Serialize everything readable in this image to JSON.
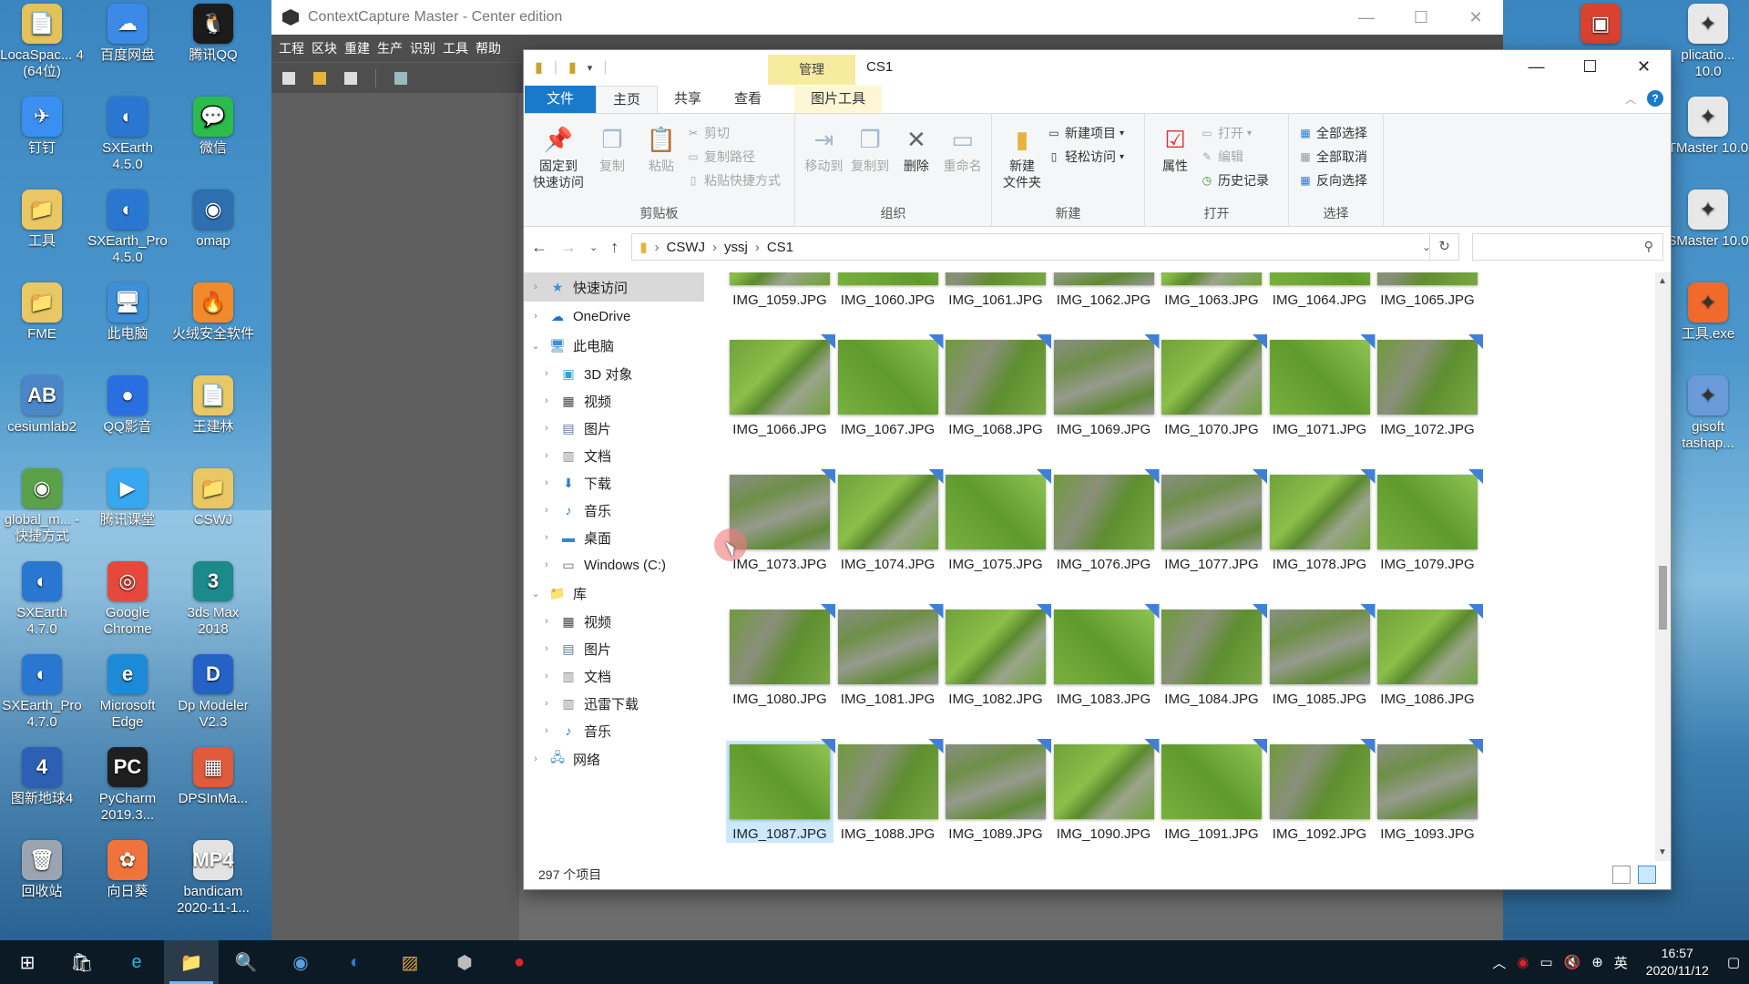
{
  "desktop": {
    "icons": [
      {
        "label": "LocaSpac... 4 (64位)",
        "color": "#e3c15b",
        "glyph": "📄",
        "col": 0,
        "row": 0
      },
      {
        "label": "钉钉",
        "color": "#3b8ff0",
        "glyph": "✈",
        "col": 0,
        "row": 1
      },
      {
        "label": "工具",
        "color": "#e9c764",
        "glyph": "📁",
        "col": 0,
        "row": 2
      },
      {
        "label": "FME",
        "color": "#e9c764",
        "glyph": "📁",
        "col": 0,
        "row": 3
      },
      {
        "label": "cesiumlab2",
        "color": "#4a86c8",
        "glyph": "AB",
        "col": 0,
        "row": 4
      },
      {
        "label": "global_m... - 快捷方式",
        "color": "#5aa14a",
        "glyph": "◉",
        "col": 0,
        "row": 5
      },
      {
        "label": "SXEarth 4.7.0",
        "color": "#2a77d1",
        "glyph": "◐",
        "col": 0,
        "row": 6
      },
      {
        "label": "SXEarth_Pro 4.7.0",
        "color": "#2a77d1",
        "glyph": "◐",
        "col": 0,
        "row": 7
      },
      {
        "label": "图新地球4",
        "color": "#2c60b5",
        "glyph": "4",
        "col": 0,
        "row": 8
      },
      {
        "label": "回收站",
        "color": "#9aa5b1",
        "glyph": "🗑",
        "col": 0,
        "row": 9
      },
      {
        "label": "百度网盘",
        "color": "#3d8ae6",
        "glyph": "☁",
        "col": 1,
        "row": 0
      },
      {
        "label": "SXEarth 4.5.0",
        "color": "#2a77d1",
        "glyph": "◐",
        "col": 1,
        "row": 1
      },
      {
        "label": "SXEarth_Pro 4.5.0",
        "color": "#2a77d1",
        "glyph": "◐",
        "col": 1,
        "row": 2
      },
      {
        "label": "此电脑",
        "color": "#3f8fd6",
        "glyph": "🖥",
        "col": 1,
        "row": 3
      },
      {
        "label": "QQ影音",
        "color": "#2a6fe0",
        "glyph": "●",
        "col": 1,
        "row": 4
      },
      {
        "label": "腾讯课堂",
        "color": "#37a7f0",
        "glyph": "▶",
        "col": 1,
        "row": 5
      },
      {
        "label": "Google Chrome",
        "color": "#e6493c",
        "glyph": "◎",
        "col": 1,
        "row": 6
      },
      {
        "label": "Microsoft Edge",
        "color": "#1d8ad7",
        "glyph": "e",
        "col": 1,
        "row": 7
      },
      {
        "label": "PyCharm 2019.3...",
        "color": "#1f1f1f",
        "glyph": "PC",
        "col": 1,
        "row": 8
      },
      {
        "label": "向日葵",
        "color": "#f0733b",
        "glyph": "✿",
        "col": 1,
        "row": 9
      },
      {
        "label": "腾讯QQ",
        "color": "#1b1b1b",
        "glyph": "🐧",
        "col": 2,
        "row": 0
      },
      {
        "label": "微信",
        "color": "#2cbc4b",
        "glyph": "💬",
        "col": 2,
        "row": 1
      },
      {
        "label": "omap",
        "color": "#2e6fb0",
        "glyph": "◉",
        "col": 2,
        "row": 2
      },
      {
        "label": "火绒安全软件",
        "color": "#f28a2b",
        "glyph": "🔥",
        "col": 2,
        "row": 3
      },
      {
        "label": "王建林",
        "color": "#e9c764",
        "glyph": "📄",
        "col": 2,
        "row": 4
      },
      {
        "label": "CSWJ",
        "color": "#e9c764",
        "glyph": "📁",
        "col": 2,
        "row": 5
      },
      {
        "label": "3ds Max 2018",
        "color": "#1a8a8a",
        "glyph": "3",
        "col": 2,
        "row": 6
      },
      {
        "label": "Dp Modeler V2.3",
        "color": "#2462c5",
        "glyph": "D",
        "col": 2,
        "row": 7
      },
      {
        "label": "DPSInMa...",
        "color": "#e05a3b",
        "glyph": "▦",
        "col": 2,
        "row": 8
      },
      {
        "label": "bandicam 2020-11-1...",
        "color": "#e3e3e3",
        "glyph": "MP4",
        "col": 2,
        "row": 9
      }
    ],
    "right_icons": [
      {
        "label": "",
        "color": "#d8432f",
        "glyph": "▣",
        "row": 0
      },
      {
        "label": "",
        "color": "#2d6ad0",
        "glyph": "◐",
        "row": 4
      }
    ],
    "right_labels": [
      {
        "label": "plicatio... 10.0",
        "row": 0
      },
      {
        "label": "TMaster 10.0",
        "row": 1
      },
      {
        "label": "SMaster 10.0",
        "row": 2
      },
      {
        "label": "工具.exe",
        "row": 3
      },
      {
        "label": "gisoft tashap...",
        "row": 4
      }
    ]
  },
  "contextcapture": {
    "title": "ContextCapture Master - Center edition",
    "menu": [
      "工程",
      "区块",
      "重建",
      "生产",
      "识别",
      "工具",
      "帮助"
    ]
  },
  "explorer": {
    "title": "CS1",
    "context_tab": "管理",
    "tabs": {
      "file": "文件",
      "home": "主页",
      "share": "共享",
      "view": "查看",
      "picture_tools": "图片工具"
    },
    "ribbon": {
      "clipboard": {
        "group": "剪贴板",
        "pin": "固定到\n快速访问",
        "copy": "复制",
        "paste": "粘贴",
        "cut": "剪切",
        "copy_path": "复制路径",
        "paste_shortcut": "粘贴快捷方式"
      },
      "organize": {
        "group": "组织",
        "move_to": "移动到",
        "copy_to": "复制到",
        "delete": "删除",
        "rename": "重命名"
      },
      "new": {
        "group": "新建",
        "new_folder": "新建\n文件夹",
        "new_item": "新建项目",
        "easy_access": "轻松访问"
      },
      "open": {
        "group": "打开",
        "properties": "属性",
        "open": "打开",
        "edit": "编辑",
        "history": "历史记录"
      },
      "select": {
        "group": "选择",
        "select_all": "全部选择",
        "select_none": "全部取消",
        "invert": "反向选择"
      }
    },
    "address": {
      "crumbs": [
        "CSWJ",
        "yssj",
        "CS1"
      ]
    },
    "search": {
      "placeholder": ""
    },
    "nav": [
      {
        "label": "快速访问",
        "level": 0,
        "chev": "›",
        "icon": "★",
        "color": "#3a8ee6",
        "sel": true
      },
      {
        "label": "OneDrive",
        "level": 0,
        "chev": "›",
        "icon": "☁",
        "color": "#1a74d0",
        "gap": true
      },
      {
        "label": "此电脑",
        "level": 0,
        "chev": "⌄",
        "icon": "🖥",
        "color": "#3f8fd6",
        "gap": true
      },
      {
        "label": "3D 对象",
        "level": 1,
        "chev": "›",
        "icon": "▣",
        "color": "#31a4d6"
      },
      {
        "label": "视频",
        "level": 1,
        "chev": "›",
        "icon": "▦",
        "color": "#444"
      },
      {
        "label": "图片",
        "level": 1,
        "chev": "›",
        "icon": "▤",
        "color": "#5a7aa0"
      },
      {
        "label": "文档",
        "level": 1,
        "chev": "›",
        "icon": "▥",
        "color": "#888"
      },
      {
        "label": "下载",
        "level": 1,
        "chev": "›",
        "icon": "⬇",
        "color": "#2a7fd6"
      },
      {
        "label": "音乐",
        "level": 1,
        "chev": "›",
        "icon": "♪",
        "color": "#2a7fd6"
      },
      {
        "label": "桌面",
        "level": 1,
        "chev": "›",
        "icon": "▬",
        "color": "#2a8ad6"
      },
      {
        "label": "Windows (C:)",
        "level": 1,
        "chev": "›",
        "icon": "▭",
        "color": "#666"
      },
      {
        "label": "库",
        "level": 0,
        "chev": "⌄",
        "icon": "📁",
        "color": "#e2b23c",
        "gap": true
      },
      {
        "label": "视频",
        "level": 1,
        "chev": "›",
        "icon": "▦",
        "color": "#444"
      },
      {
        "label": "图片",
        "level": 1,
        "chev": "›",
        "icon": "▤",
        "color": "#5a7aa0"
      },
      {
        "label": "文档",
        "level": 1,
        "chev": "›",
        "icon": "▥",
        "color": "#888"
      },
      {
        "label": "迅雷下载",
        "level": 1,
        "chev": "›",
        "icon": "▥",
        "color": "#888"
      },
      {
        "label": "音乐",
        "level": 1,
        "chev": "›",
        "icon": "♪",
        "color": "#2a7fd6"
      },
      {
        "label": "网络",
        "level": 0,
        "chev": "›",
        "icon": "🖧",
        "color": "#3f8fd6",
        "gap": true
      }
    ],
    "files_top_row": [
      "IMG_1059.JPG",
      "IMG_1060.JPG",
      "IMG_1061.JPG",
      "IMG_1062.JPG",
      "IMG_1063.JPG",
      "IMG_1064.JPG",
      "IMG_1065.JPG"
    ],
    "files": [
      [
        "IMG_1066.JPG",
        "IMG_1067.JPG",
        "IMG_1068.JPG",
        "IMG_1069.JPG",
        "IMG_1070.JPG",
        "IMG_1071.JPG",
        "IMG_1072.JPG"
      ],
      [
        "IMG_1073.JPG",
        "IMG_1074.JPG",
        "IMG_1075.JPG",
        "IMG_1076.JPG",
        "IMG_1077.JPG",
        "IMG_1078.JPG",
        "IMG_1079.JPG"
      ],
      [
        "IMG_1080.JPG",
        "IMG_1081.JPG",
        "IMG_1082.JPG",
        "IMG_1083.JPG",
        "IMG_1084.JPG",
        "IMG_1085.JPG",
        "IMG_1086.JPG"
      ],
      [
        "IMG_1087.JPG",
        "IMG_1088.JPG",
        "IMG_1089.JPG",
        "IMG_1090.JPG",
        "IMG_1091.JPG",
        "IMG_1092.JPG",
        "IMG_1093.JPG"
      ]
    ],
    "selected_file": "IMG_1087.JPG",
    "status": "297 个项目"
  },
  "taskbar": {
    "apps": [
      {
        "name": "start-button",
        "glyph": "⊞",
        "color": "#fff"
      },
      {
        "name": "store-icon",
        "glyph": "🛍",
        "color": "#fff"
      },
      {
        "name": "edge-icon",
        "glyph": "e",
        "color": "#35b1e8"
      },
      {
        "name": "file-explorer-icon",
        "glyph": "📁",
        "color": "#f5c24a",
        "active": true
      },
      {
        "name": "magnifier-icon",
        "glyph": "🔍",
        "color": "#9cd0ef"
      },
      {
        "name": "globe-app-icon",
        "glyph": "◉",
        "color": "#5aa0e0"
      },
      {
        "name": "sxearth-icon",
        "glyph": "◐",
        "color": "#2a77d1"
      },
      {
        "name": "map-app-icon",
        "glyph": "▨",
        "color": "#d8a440"
      },
      {
        "name": "contextcapture-icon",
        "glyph": "⬢",
        "color": "#bbb"
      },
      {
        "name": "bandicam-icon",
        "glyph": "●",
        "color": "#e0232b"
      }
    ],
    "tray": {
      "ime": "英",
      "time": "16:57",
      "date": "2020/11/12"
    }
  }
}
